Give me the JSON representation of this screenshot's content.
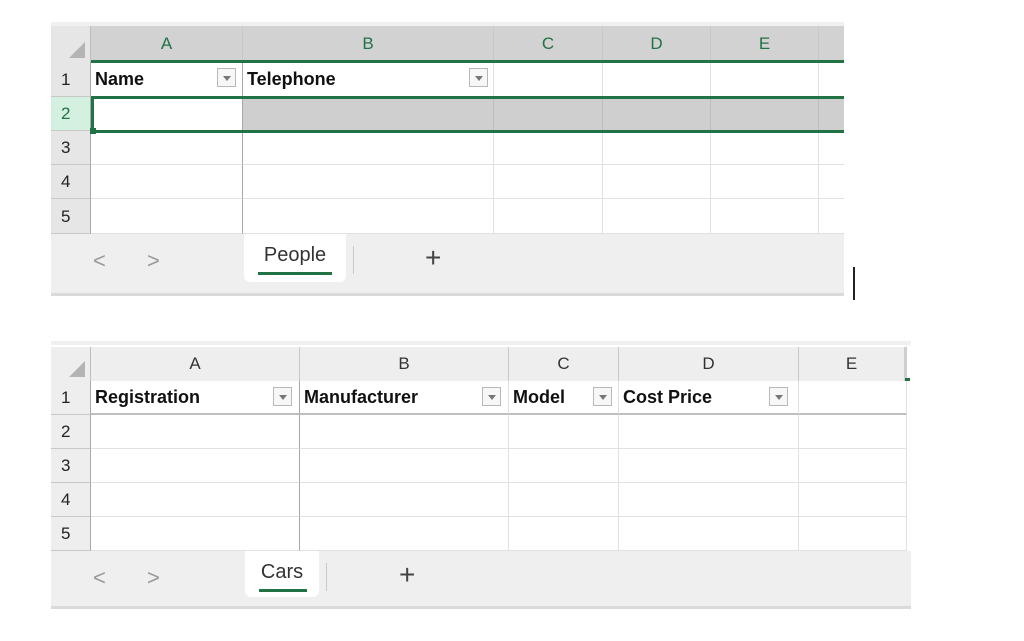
{
  "sheets": [
    {
      "id": "people",
      "columns": [
        "A",
        "B",
        "C",
        "D",
        "E"
      ],
      "selected_column_headers": [
        "A",
        "B",
        "C",
        "D",
        "E"
      ],
      "rows": [
        "1",
        "2",
        "3",
        "4",
        "5"
      ],
      "selected_row": "2",
      "headers": [
        {
          "col": "A",
          "label": "Name",
          "filter": true
        },
        {
          "col": "B",
          "label": "Telephone",
          "filter": true
        },
        {
          "col": "C",
          "label": "",
          "filter": false
        },
        {
          "col": "D",
          "label": "",
          "filter": false
        },
        {
          "col": "E",
          "label": "",
          "filter": false
        }
      ],
      "active_cell": "A2",
      "tab": {
        "label": "People",
        "active": true
      },
      "nav": {
        "prev": "<",
        "next": ">"
      },
      "add_sheet": "+"
    },
    {
      "id": "cars",
      "columns": [
        "A",
        "B",
        "C",
        "D",
        "E"
      ],
      "rows": [
        "1",
        "2",
        "3",
        "4",
        "5"
      ],
      "headers": [
        {
          "col": "A",
          "label": "Registration",
          "filter": true
        },
        {
          "col": "B",
          "label": "Manufacturer",
          "filter": true
        },
        {
          "col": "C",
          "label": "Model",
          "filter": true
        },
        {
          "col": "D",
          "label": "Cost Price",
          "filter": true
        },
        {
          "col": "E",
          "label": "",
          "filter": false
        }
      ],
      "tab": {
        "label": "Cars",
        "active": true
      },
      "nav": {
        "prev": "<",
        "next": ">"
      },
      "add_sheet": "+"
    }
  ],
  "colors": {
    "accent_green": "#217346",
    "selected_row_header_bg": "#d3f0e0",
    "header_bg": "#e6e6e6",
    "selected_row_fill": "#cfcfcf"
  }
}
